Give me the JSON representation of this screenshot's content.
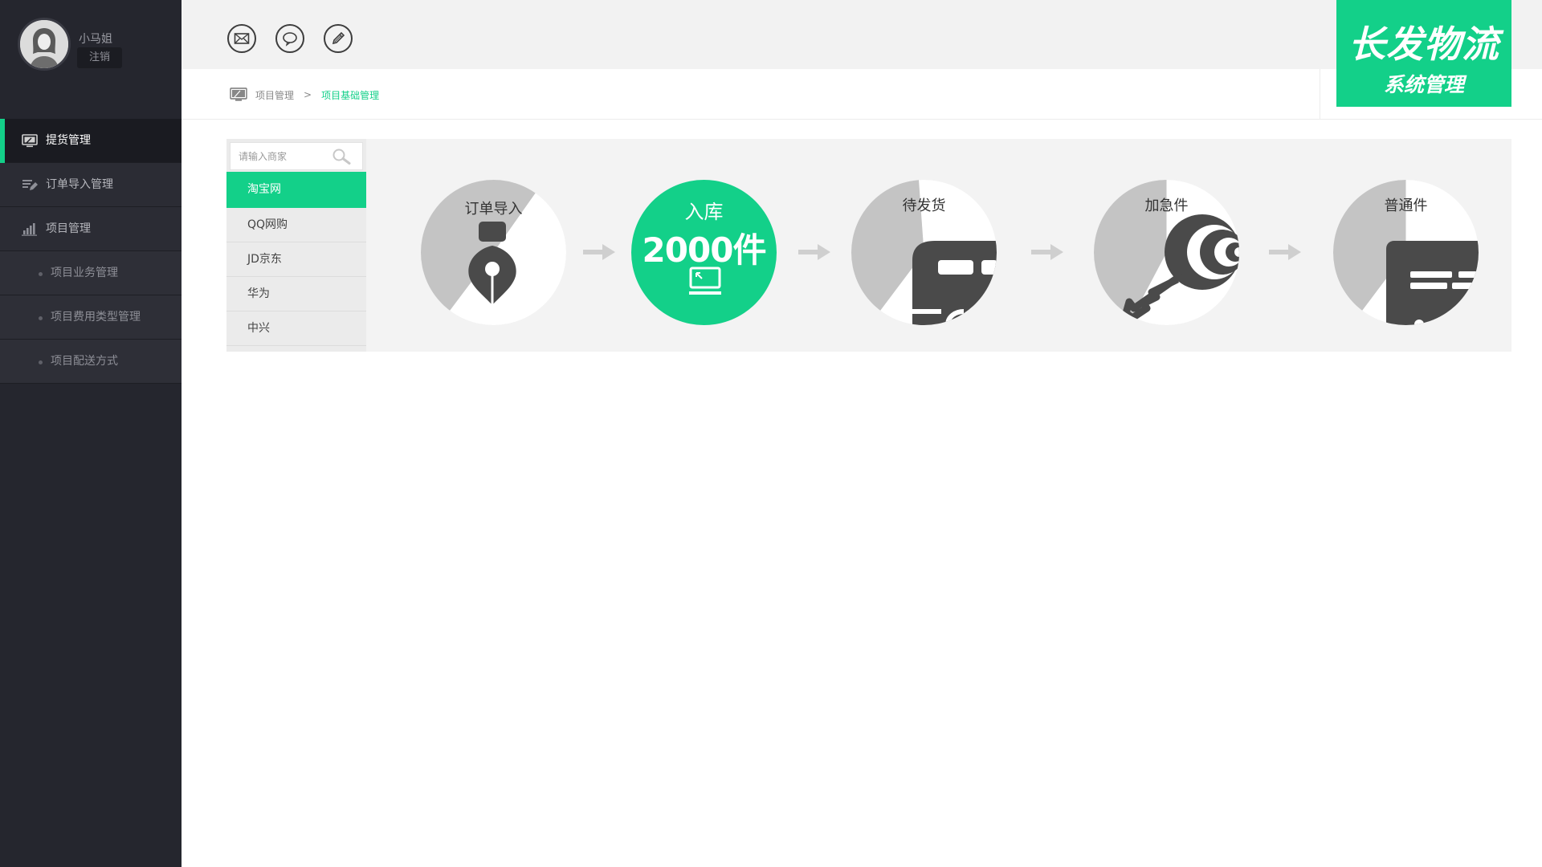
{
  "user": {
    "name": "小马姐",
    "logout_label": "注销"
  },
  "sidebar": {
    "items": [
      {
        "label": "提货管理",
        "icon": "monitor-icon",
        "active": true
      },
      {
        "label": "订单导入管理",
        "icon": "edit-list-icon",
        "active": false
      },
      {
        "label": "项目管理",
        "icon": "bar-chart-icon",
        "active": false
      }
    ],
    "sub_items": [
      {
        "label": "项目业务管理"
      },
      {
        "label": "项目费用类型管理"
      },
      {
        "label": "项目配送方式"
      }
    ]
  },
  "topbar": {
    "icons": [
      "mail-icon",
      "chat-icon",
      "edit-icon"
    ]
  },
  "brand": {
    "title": "长发物流",
    "subtitle": "系统管理",
    "color": "#13d089"
  },
  "breadcrumb": {
    "parent": "项目管理",
    "separator": ">",
    "current": "项目基础管理"
  },
  "search": {
    "placeholder": "请输入商家"
  },
  "merchants": [
    {
      "label": "淘宝网",
      "active": true
    },
    {
      "label": "QQ网购",
      "active": false
    },
    {
      "label": "JD京东",
      "active": false
    },
    {
      "label": "华为",
      "active": false
    },
    {
      "label": "中兴",
      "active": false
    }
  ],
  "steps": [
    {
      "label": "订单导入",
      "icon": "pen-nib-icon"
    },
    {
      "label": "入库",
      "count": "2000件",
      "icon": "laptop-icon",
      "active": true
    },
    {
      "label": "待发货",
      "icon": "truck-icon"
    },
    {
      "label": "加急件",
      "icon": "key-icon"
    },
    {
      "label": "普通件",
      "icon": "document-icon"
    }
  ],
  "colors": {
    "accent": "#13d089",
    "sidebar_bg": "#25262e",
    "step_grey": "#c4c4c4",
    "icon_dark": "#4a4a4a"
  }
}
